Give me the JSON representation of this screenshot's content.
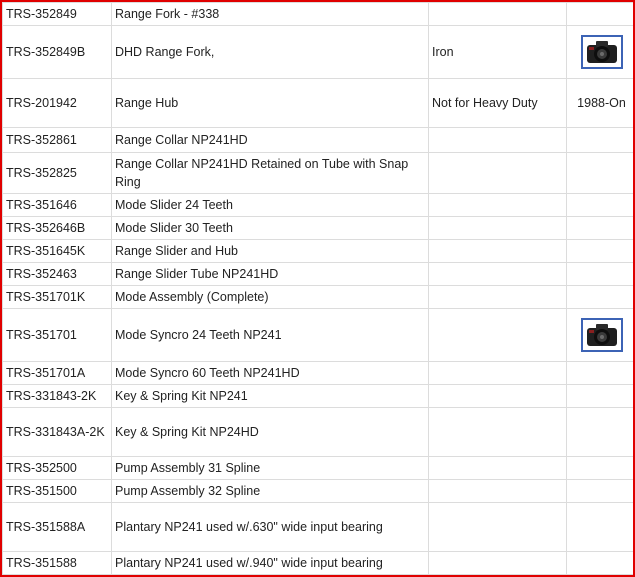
{
  "table": {
    "rows": [
      {
        "part": "TRS-352849",
        "desc": "Range Fork - #338",
        "note": "",
        "year": "",
        "photo": false
      },
      {
        "part": "TRS-352849B",
        "desc": "DHD Range Fork,",
        "note": "Iron",
        "year": "",
        "photo": true
      },
      {
        "part": "TRS-201942",
        "desc": "Range Hub",
        "note": "Not for Heavy Duty",
        "year": "1988-On",
        "photo": false
      },
      {
        "part": "TRS-352861",
        "desc": "Range Collar NP241HD",
        "note": "",
        "year": "",
        "photo": false
      },
      {
        "part": "TRS-352825",
        "desc": "Range Collar NP241HD Retained on Tube with Snap Ring",
        "note": "",
        "year": "",
        "photo": false
      },
      {
        "part": "TRS-351646",
        "desc": "Mode Slider 24 Teeth",
        "note": "",
        "year": "",
        "photo": false
      },
      {
        "part": "TRS-352646B",
        "desc": "Mode Slider 30 Teeth",
        "note": "",
        "year": "",
        "photo": false
      },
      {
        "part": "TRS-351645K",
        "desc": "Range Slider and Hub",
        "note": "",
        "year": "",
        "photo": false
      },
      {
        "part": "TRS-352463",
        "desc": "Range Slider Tube NP241HD",
        "note": "",
        "year": "",
        "photo": false
      },
      {
        "part": "TRS-351701K",
        "desc": "Mode Assembly (Complete)",
        "note": "",
        "year": "",
        "photo": false
      },
      {
        "part": "TRS-351701",
        "desc": "Mode Syncro 24 Teeth NP241",
        "note": "",
        "year": "",
        "photo": true
      },
      {
        "part": "TRS-351701A",
        "desc": "Mode Syncro 60 Teeth NP241HD",
        "note": "",
        "year": "",
        "photo": false
      },
      {
        "part": "TRS-331843-2K",
        "desc": "Key & Spring Kit NP241",
        "note": "",
        "year": "",
        "photo": false
      },
      {
        "part": "TRS-331843A-2K",
        "desc": "Key & Spring Kit NP24HD",
        "note": "",
        "year": "",
        "photo": false
      },
      {
        "part": "TRS-352500",
        "desc": "Pump Assembly 31 Spline",
        "note": "",
        "year": "",
        "photo": false
      },
      {
        "part": "TRS-351500",
        "desc": "Pump Assembly 32 Spline",
        "note": "",
        "year": "",
        "photo": false
      },
      {
        "part": "TRS-351588A",
        "desc": "Plantary NP241 used w/.630\" wide input bearing",
        "note": "",
        "year": "",
        "photo": false
      },
      {
        "part": "TRS-351588",
        "desc": "Plantary NP241 used w/.940\" wide input bearing",
        "note": "",
        "year": "",
        "photo": false
      }
    ]
  },
  "colors": {
    "frame_border": "#e00000",
    "grid": "#dcdcdc",
    "photo_border": "#3c63b5"
  },
  "icons": {
    "photo": "camera-icon"
  }
}
